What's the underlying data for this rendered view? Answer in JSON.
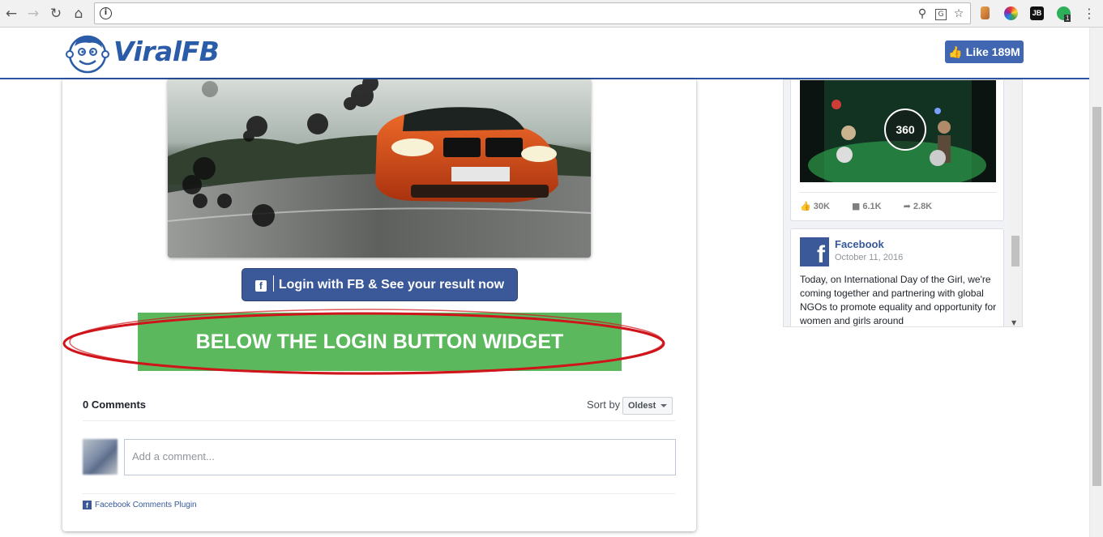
{
  "browser": {
    "back_icon": "arrow-left-icon",
    "forward_icon": "arrow-right-icon",
    "reload_icon": "reload-icon",
    "home_icon": "home-icon",
    "info_icon": "i",
    "url": "",
    "extension_badge": "1",
    "jb_label": "JB"
  },
  "header": {
    "logo_text": "ViralFB",
    "like_label": "Like 189M"
  },
  "main": {
    "login_button": "Login with FB & See your result now",
    "widget_label": "BELOW THE LOGIN BUTTON WIDGET",
    "comments": {
      "count_label": "0 Comments",
      "sort_label": "Sort by",
      "sort_value": "Oldest",
      "input_placeholder": "Add a comment...",
      "plugin_label": "Facebook Comments Plugin"
    }
  },
  "sidebar_widget": {
    "video_badge": "360",
    "stats": {
      "likes": "30K",
      "comments": "6.1K",
      "shares": "2.8K"
    },
    "post": {
      "page_name": "Facebook",
      "date": "October 11, 2016",
      "text": "Today, on International Day of the Girl, we're coming together and partnering with global NGOs to promote equality and opportunity for women and girls around"
    }
  },
  "colors": {
    "brand": "#2b5ca8",
    "facebook": "#3b5998",
    "widget_green": "#5cb85c",
    "highlight_ellipse": "#d0141b"
  }
}
